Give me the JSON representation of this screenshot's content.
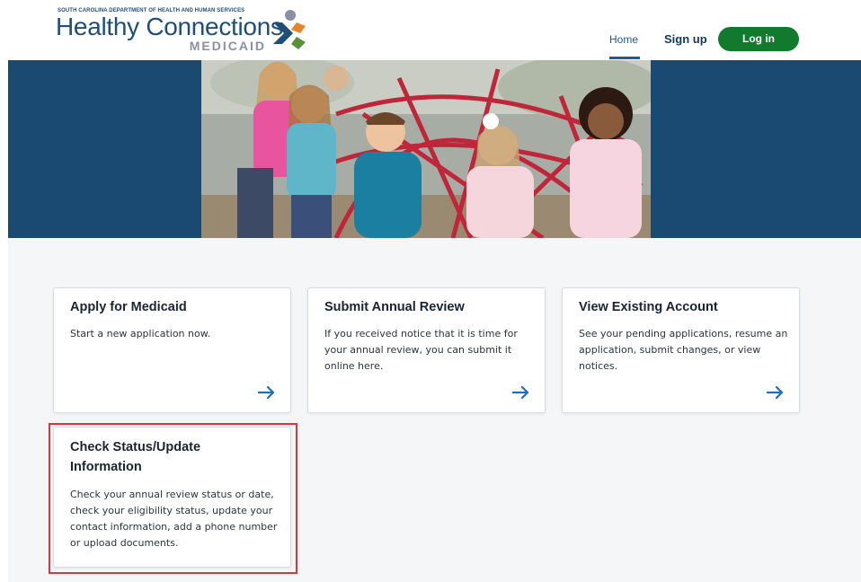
{
  "header": {
    "logo": {
      "dept": "SOUTH CAROLINA DEPARTMENT OF HEALTH AND HUMAN SERVICES",
      "name": "Healthy Connections",
      "sub": "MEDICAID"
    },
    "nav": {
      "home": "Home",
      "signup": "Sign up",
      "login": "Log in"
    }
  },
  "colors": {
    "brand_blue": "#1f4e79",
    "hero_bg": "#1a4a72",
    "login_green": "#117a2c",
    "arrow_blue": "#1f6fb8",
    "highlight_red": "#d9363e",
    "logo_green": "#5a8f3c",
    "logo_orange": "#e8842c",
    "logo_blue": "#2a6aa8"
  },
  "hero": {
    "photo": "children-on-playground-photo"
  },
  "cards": [
    {
      "title": "Apply for Medicaid",
      "desc": "Start a new application now.",
      "icon": "arrow-right-icon"
    },
    {
      "title": "Submit Annual Review",
      "desc_lines": [
        "If you received notice that it is time for",
        "your annual review, you can submit it",
        "online here."
      ],
      "icon": "arrow-right-icon"
    },
    {
      "title": "View Existing Account",
      "desc_lines": [
        "See your pending applications, resume an",
        "application, submit changes, or view",
        "notices."
      ],
      "icon": "arrow-right-icon"
    },
    {
      "title_lines": [
        "Check Status/Update",
        "Information"
      ],
      "desc_lines": [
        "Check your annual review status or date,",
        "check your eligibility status, update your",
        "contact information, add a phone number",
        "or upload documents."
      ]
    }
  ]
}
